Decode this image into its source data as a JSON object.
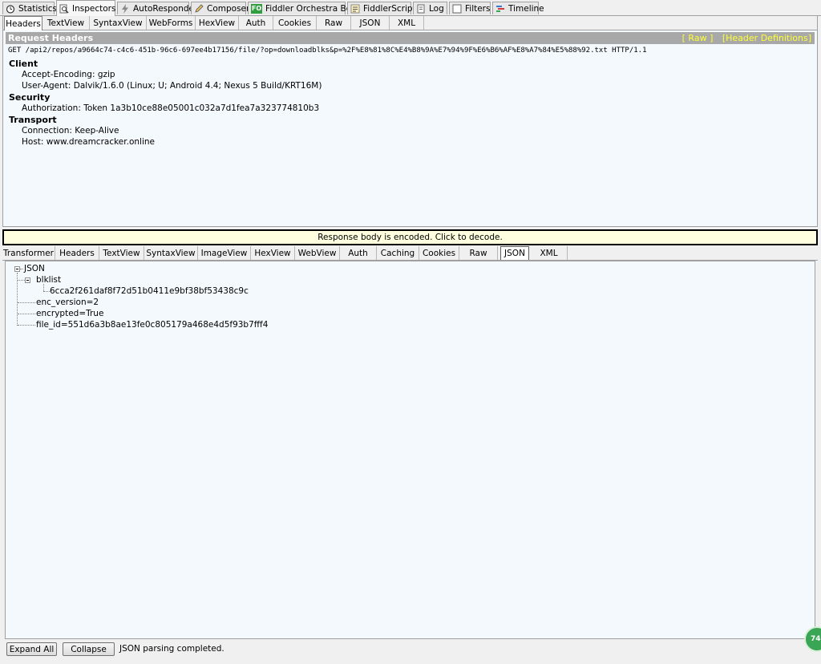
{
  "main_tabs": [
    {
      "label": "Statistics",
      "icon": "stopwatch-icon"
    },
    {
      "label": "Inspectors",
      "icon": "magnifier-icon"
    },
    {
      "label": "AutoResponder",
      "icon": "lightning-icon"
    },
    {
      "label": "Composer",
      "icon": "pencil-icon"
    },
    {
      "label": "Fiddler Orchestra Beta",
      "icon": "fo-badge-icon",
      "badge": "FO"
    },
    {
      "label": "FiddlerScript",
      "icon": "script-icon"
    },
    {
      "label": "Log",
      "icon": "log-icon"
    },
    {
      "label": "Filters",
      "icon": "checkbox-icon"
    },
    {
      "label": "Timeline",
      "icon": "timeline-icon"
    }
  ],
  "request": {
    "tabs": [
      "Headers",
      "TextView",
      "SyntaxView",
      "WebForms",
      "HexView",
      "Auth",
      "Cookies",
      "Raw",
      "JSON",
      "XML"
    ],
    "active_tab": "Headers",
    "title": "Request Headers",
    "links": {
      "raw": "[ Raw ]",
      "definitions": "[Header Definitions]"
    },
    "request_line": "GET /api2/repos/a9664c74-c4c6-451b-96c6-697ee4b17156/file/?op=downloadblks&p=%2F%E8%81%8C%E4%B8%9A%E7%94%9F%E6%B6%AF%E8%A7%84%E5%88%92.txt HTTP/1.1",
    "sections": [
      {
        "name": "Client",
        "items": [
          "Accept-Encoding: gzip",
          "User-Agent: Dalvik/1.6.0 (Linux; U; Android 4.4; Nexus 5 Build/KRT16M)"
        ]
      },
      {
        "name": "Security",
        "items": [
          "Authorization: Token 1a3b10ce88e05001c032a7d1fea7a323774810b3"
        ]
      },
      {
        "name": "Transport",
        "items": [
          "Connection: Keep-Alive",
          "Host: www.dreamcracker.online"
        ]
      }
    ]
  },
  "banner": "Response body is encoded. Click to decode.",
  "response": {
    "tabs": [
      "Transformer",
      "Headers",
      "TextView",
      "SyntaxView",
      "ImageView",
      "HexView",
      "WebView",
      "Auth",
      "Caching",
      "Cookies",
      "Raw",
      "JSON",
      "XML"
    ],
    "active_tab": "JSON",
    "tree": {
      "root": "JSON",
      "blklist": "blklist",
      "blk_item": "6cca2f261daf8f72d51b0411e9bf38bf53438c9c",
      "enc_version": "enc_version=2",
      "encrypted": "encrypted=True",
      "file_id": "file_id=551d6a3b8ae13fe0c805179a468e4d5f93b7fff4"
    }
  },
  "bottom": {
    "expand_all": "Expand All",
    "collapse": "Collapse",
    "status": "JSON parsing completed."
  },
  "corner_badge": "74"
}
